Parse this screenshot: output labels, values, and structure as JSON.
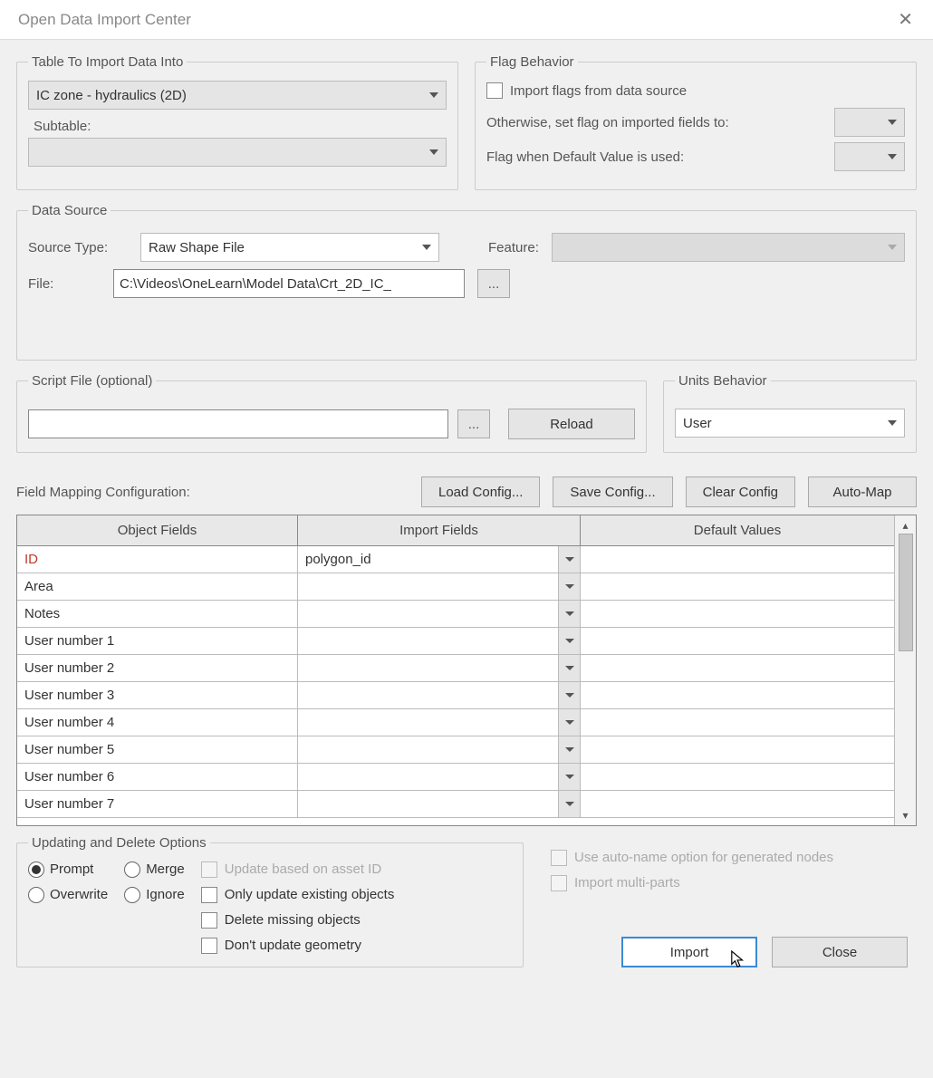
{
  "window": {
    "title": "Open Data Import Center"
  },
  "tableGroup": {
    "legend": "Table To Import Data Into",
    "tableSelect": "IC zone - hydraulics (2D)",
    "subtableLabel": "Subtable:",
    "subtableSelect": ""
  },
  "flagGroup": {
    "legend": "Flag Behavior",
    "importFlagsLabel": "Import flags from data source",
    "otherwiseLabel": "Otherwise, set flag on imported fields to:",
    "defaultFlagLabel": "Flag when Default Value is used:"
  },
  "dataSource": {
    "legend": "Data Source",
    "sourceTypeLabel": "Source Type:",
    "sourceTypeValue": "Raw Shape File",
    "featureLabel": "Feature:",
    "featureValue": "",
    "fileLabel": "File:",
    "fileValue": "C:\\Videos\\OneLearn\\Model Data\\Crt_2D_IC_"
  },
  "scriptGroup": {
    "legend": "Script File (optional)",
    "value": "",
    "reloadLabel": "Reload"
  },
  "unitsGroup": {
    "legend": "Units Behavior",
    "value": "User"
  },
  "fieldMapping": {
    "label": "Field Mapping Configuration:",
    "loadConfig": "Load Config...",
    "saveConfig": "Save Config...",
    "clearConfig": "Clear Config",
    "autoMap": "Auto-Map",
    "headers": {
      "objectFields": "Object Fields",
      "importFields": "Import Fields",
      "defaultValues": "Default Values"
    },
    "rows": [
      {
        "object": "ID",
        "import": "polygon_id",
        "default": "",
        "highlight": true
      },
      {
        "object": "Area",
        "import": "",
        "default": ""
      },
      {
        "object": "Notes",
        "import": "",
        "default": ""
      },
      {
        "object": "User number 1",
        "import": "",
        "default": ""
      },
      {
        "object": "User number 2",
        "import": "",
        "default": ""
      },
      {
        "object": "User number 3",
        "import": "",
        "default": ""
      },
      {
        "object": "User number 4",
        "import": "",
        "default": ""
      },
      {
        "object": "User number 5",
        "import": "",
        "default": ""
      },
      {
        "object": "User number 6",
        "import": "",
        "default": ""
      },
      {
        "object": "User number 7",
        "import": "",
        "default": ""
      }
    ]
  },
  "updateOptions": {
    "legend": "Updating and Delete Options",
    "prompt": "Prompt",
    "merge": "Merge",
    "overwrite": "Overwrite",
    "ignore": "Ignore",
    "updateAssetId": "Update based on asset ID",
    "onlyExisting": "Only update existing objects",
    "deleteMissing": "Delete missing objects",
    "dontUpdateGeom": "Don't update geometry"
  },
  "rightOptions": {
    "autoName": "Use auto-name option for generated nodes",
    "multiParts": "Import multi-parts"
  },
  "footer": {
    "import": "Import",
    "close": "Close"
  }
}
